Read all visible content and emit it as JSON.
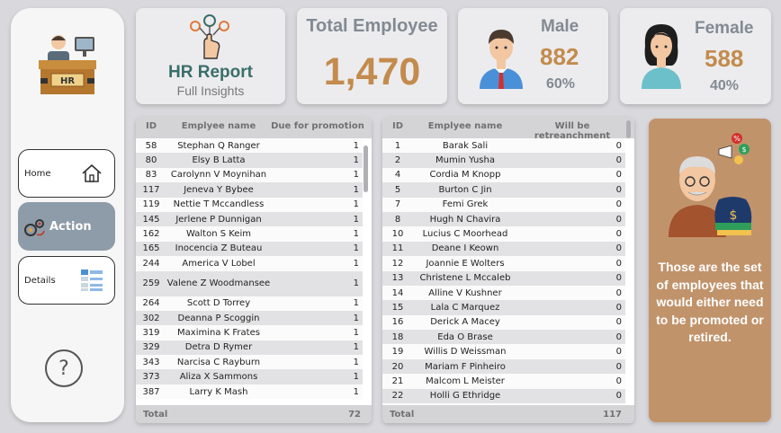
{
  "nav": {
    "home_label": "Home",
    "action_label": "Action",
    "details_label": "Details",
    "help_label": "?"
  },
  "report": {
    "title": "HR Report",
    "subtitle": "Full Insights"
  },
  "total": {
    "label": "Total Employee",
    "value": "1,470"
  },
  "male": {
    "label": "Male",
    "value": "882",
    "pct": "60%"
  },
  "female": {
    "label": "Female",
    "value": "588",
    "pct": "40%"
  },
  "promotion_table": {
    "headers": [
      "ID",
      "Emplyee name",
      "Due for promotion"
    ],
    "rows": [
      [
        "58",
        "Stephan Q Ranger",
        "1"
      ],
      [
        "80",
        "Elsy B Latta",
        "1"
      ],
      [
        "83",
        "Carolynn V Moynihan",
        "1"
      ],
      [
        "117",
        "Jeneva Y Bybee",
        "1"
      ],
      [
        "119",
        "Nettie T Mccandless",
        "1"
      ],
      [
        "145",
        "Jerlene P Dunnigan",
        "1"
      ],
      [
        "162",
        "Walton S Keim",
        "1"
      ],
      [
        "165",
        "Inocencia Z Buteau",
        "1"
      ],
      [
        "244",
        "America V Lobel",
        "1"
      ],
      [
        "259",
        "Valene Z Woodmansee",
        "1"
      ],
      [
        "264",
        "Scott D Torrey",
        "1"
      ],
      [
        "302",
        "Deanna P Scoggin",
        "1"
      ],
      [
        "319",
        "Maximina K Frates",
        "1"
      ],
      [
        "329",
        "Detra D Rymer",
        "1"
      ],
      [
        "343",
        "Narcisa C Rayburn",
        "1"
      ],
      [
        "373",
        "Aliza X Sammons",
        "1"
      ],
      [
        "387",
        "Larry K Mash",
        "1"
      ]
    ],
    "total_label": "Total",
    "total_value": "72"
  },
  "retrench_table": {
    "headers": [
      "ID",
      "Emplyee name",
      "Will be retreanchment"
    ],
    "rows": [
      [
        "1",
        "Barak Sali",
        "0"
      ],
      [
        "2",
        "Mumin Yusha",
        "0"
      ],
      [
        "4",
        "Cordia M Knopp",
        "0"
      ],
      [
        "5",
        "Burton C Jin",
        "0"
      ],
      [
        "7",
        "Femi Grek",
        "0"
      ],
      [
        "8",
        "Hugh N Chavira",
        "0"
      ],
      [
        "10",
        "Lucius C Moorhead",
        "0"
      ],
      [
        "11",
        "Deane I Keown",
        "0"
      ],
      [
        "12",
        "Joannie E Wolters",
        "0"
      ],
      [
        "13",
        "Christene L Mccaleb",
        "0"
      ],
      [
        "14",
        "Alline V Kushner",
        "0"
      ],
      [
        "15",
        "Lala C Marquez",
        "0"
      ],
      [
        "16",
        "Derick A Macey",
        "0"
      ],
      [
        "18",
        "Eda O Brase",
        "0"
      ],
      [
        "19",
        "Willis D Weissman",
        "0"
      ],
      [
        "20",
        "Mariam F Pinheiro",
        "0"
      ],
      [
        "21",
        "Malcom L Meister",
        "0"
      ],
      [
        "22",
        "Holli G Ethridge",
        "0"
      ]
    ],
    "total_label": "Total",
    "total_value": "117"
  },
  "info": {
    "text": "Those are the set of employees that would either need to be promoted or retired."
  },
  "colors": {
    "accent": "#c38b4d",
    "teal": "#3a6e6a",
    "info_bg": "#c1936b",
    "nav_active": "#8e9ba8"
  }
}
